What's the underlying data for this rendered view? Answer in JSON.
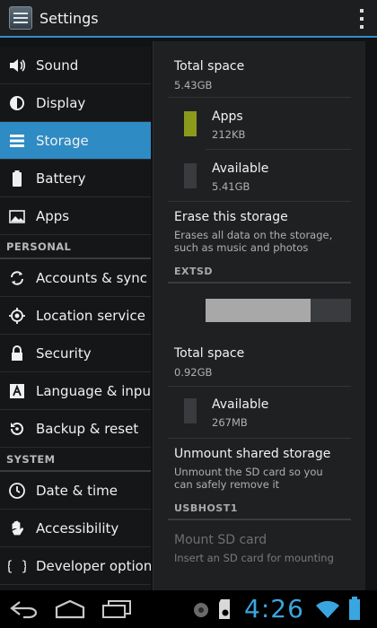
{
  "app": {
    "title": "Settings"
  },
  "sidebar": {
    "items_top": [
      {
        "id": "sound",
        "label": "Sound"
      },
      {
        "id": "display",
        "label": "Display"
      },
      {
        "id": "storage",
        "label": "Storage",
        "selected": true
      },
      {
        "id": "battery",
        "label": "Battery"
      },
      {
        "id": "apps",
        "label": "Apps"
      }
    ],
    "personal_header": "PERSONAL",
    "items_personal": [
      {
        "id": "accounts",
        "label": "Accounts & sync"
      },
      {
        "id": "location",
        "label": "Location service"
      },
      {
        "id": "security",
        "label": "Security"
      },
      {
        "id": "language",
        "label": "Language & inpu"
      },
      {
        "id": "backup",
        "label": "Backup & reset"
      }
    ],
    "system_header": "SYSTEM",
    "items_system": [
      {
        "id": "datetime",
        "label": "Date & time"
      },
      {
        "id": "accessibility",
        "label": "Accessibility"
      },
      {
        "id": "developer",
        "label": "Developer option"
      }
    ]
  },
  "storage": {
    "internal": {
      "total_title": "Total space",
      "total_value": "5.43GB",
      "apps_label": "Apps",
      "apps_value": "212KB",
      "available_label": "Available",
      "available_value": "5.41GB",
      "erase_title": "Erase this storage",
      "erase_summary": "Erases all data on the storage, such as music and photos"
    },
    "extsd": {
      "header": "EXTSD",
      "used_fraction": 0.72,
      "total_title": "Total space",
      "total_value": "0.92GB",
      "available_label": "Available",
      "available_value": "267MB",
      "unmount_title": "Unmount shared storage",
      "unmount_summary": "Unmount the SD card so you can safely remove it"
    },
    "usbhost": {
      "header": "USBHOST1",
      "mount_title": "Mount SD card",
      "mount_summary": "Insert an SD card for mounting"
    }
  },
  "statusbar": {
    "time": "4:26"
  },
  "colors": {
    "accent": "#2e8bc4",
    "apps_swatch": "#8c9a1c",
    "available_swatch": "#3a3b3e",
    "clock": "#3aa6e0"
  }
}
